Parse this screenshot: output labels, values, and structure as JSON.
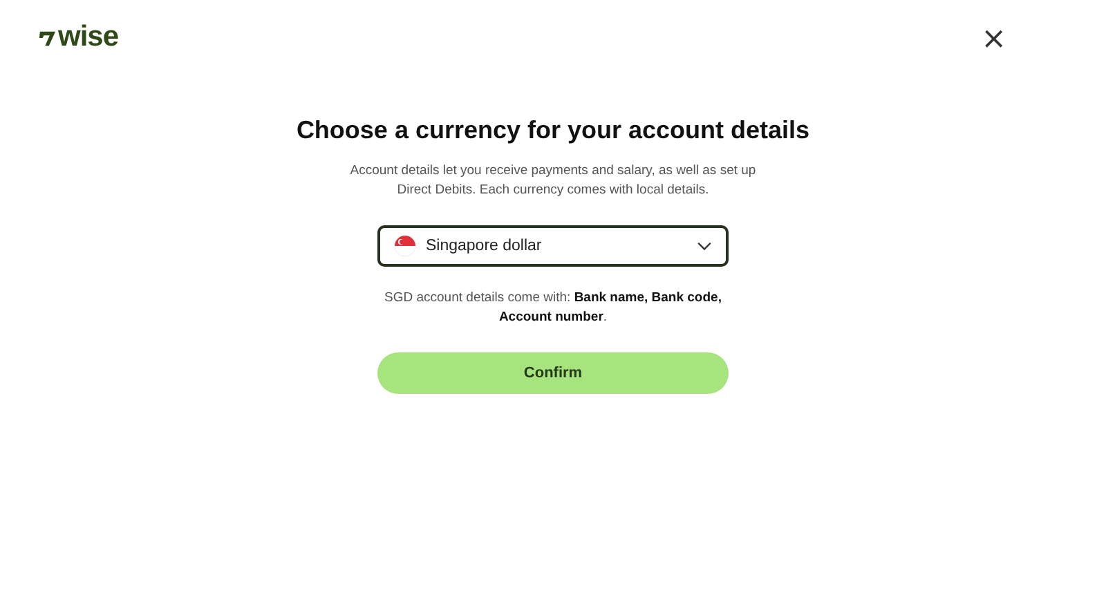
{
  "header": {
    "logo_text": "wise",
    "close": "×"
  },
  "title": "Choose a currency for your account details",
  "subtitle": "Account details let you receive payments and salary, as well as set up Direct Debits. Each currency comes with local details.",
  "currency_select": {
    "value": "Singapore dollar",
    "expanded": false
  },
  "details_note": "SGD account details come with: **Bank name, Bank code, Account number**.",
  "confirm_button": "Confirm"
}
